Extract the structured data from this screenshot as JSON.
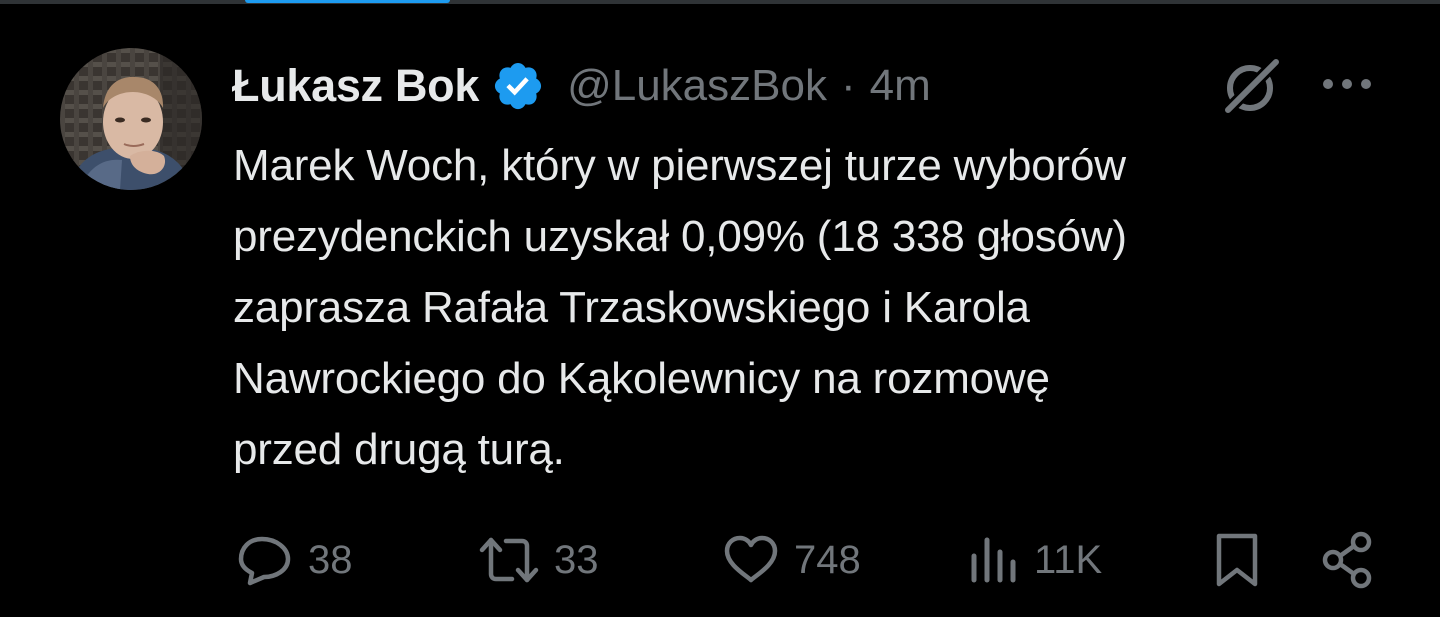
{
  "tweet": {
    "author": {
      "name": "Łukasz Bok",
      "handle": "@LukaszBok",
      "verified": true
    },
    "separator": "·",
    "timestamp": "4m",
    "text_lines": [
      "Marek Woch, który w pierwszej turze wyborów",
      "prezydenckich uzyskał 0,09% (18 338 głosów)",
      "zaprasza Rafała Trzaskowskiego i Karola",
      "Nawrockiego do Kąkolewnicy na rozmowę",
      "przed drugą turą."
    ]
  },
  "actions": {
    "replies": "38",
    "reposts": "33",
    "likes": "748",
    "views": "11K"
  },
  "icons": {
    "header": [
      "grok-icon",
      "more-icon",
      "verified-badge-icon"
    ],
    "actions": [
      "reply-icon",
      "repost-icon",
      "like-icon",
      "views-icon",
      "bookmark-icon",
      "share-icon"
    ]
  },
  "colors": {
    "background": "#000000",
    "text_primary": "#e7e9ea",
    "text_secondary": "#71767b",
    "accent": "#1d9bf0"
  }
}
